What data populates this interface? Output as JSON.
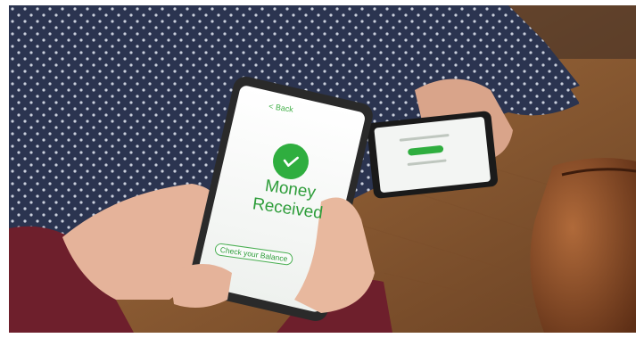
{
  "scene": {
    "phone_screen": {
      "back_link": "< Back",
      "status_icon": "checkmark-icon",
      "title_line1": "Money",
      "title_line2": "Received",
      "balance_button": "Check your Balance"
    },
    "colors": {
      "accent_green": "#2fae3f",
      "shirt_navy": "#2b3450",
      "table_wood": "#9a6a3e",
      "sweater_maroon": "#6e1f2c",
      "wallet_brown": "#8a4b26"
    }
  }
}
